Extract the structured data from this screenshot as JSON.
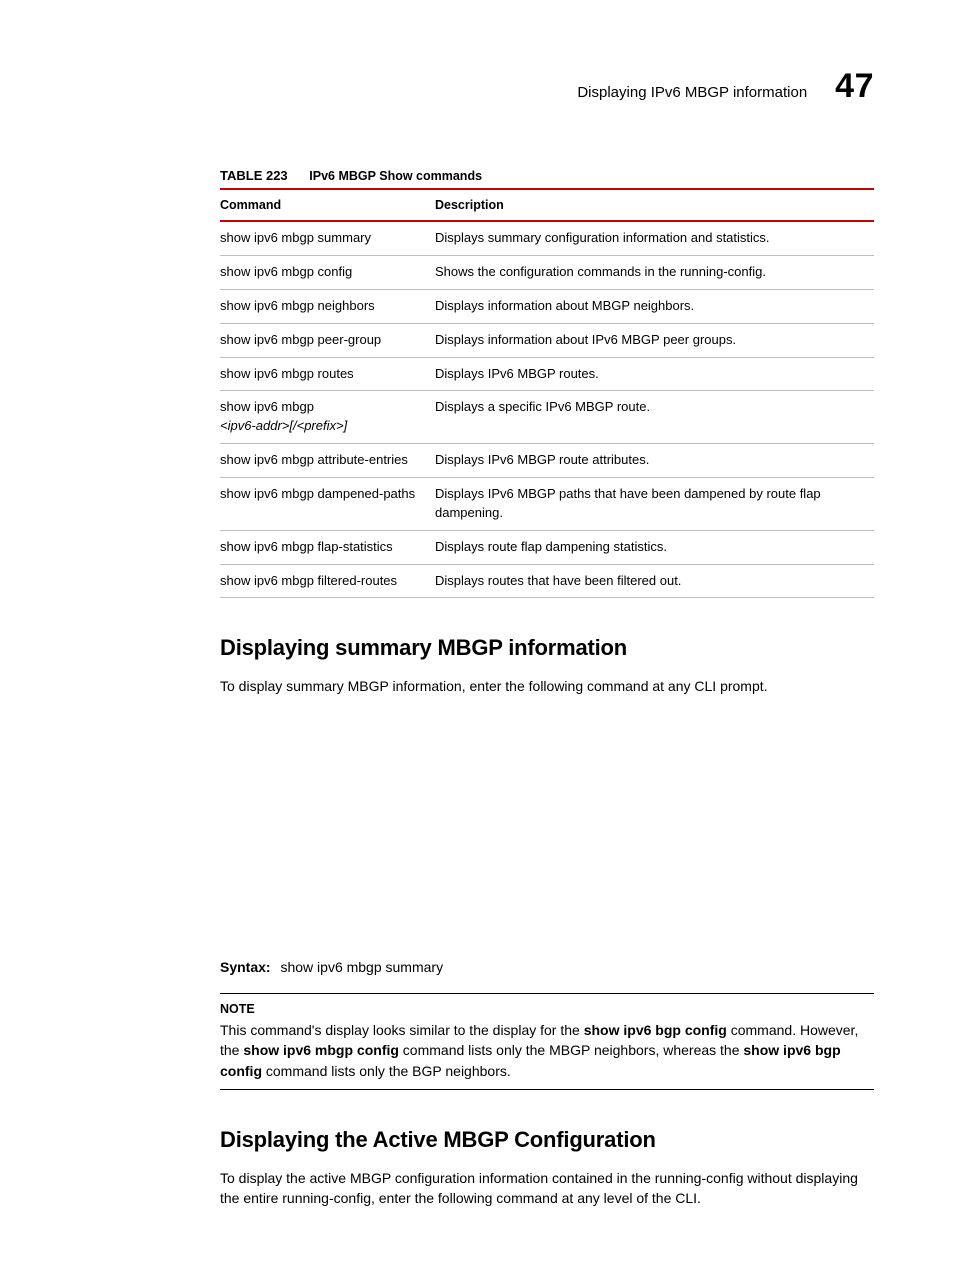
{
  "header": {
    "section_title": "Displaying IPv6 MBGP information",
    "chapter_number": "47"
  },
  "table": {
    "label": "TABLE 223",
    "title": "IPv6 MBGP Show commands",
    "col_command": "Command",
    "col_description": "Description",
    "rows": [
      {
        "command": "show ipv6 mbgp summary",
        "description": "Displays summary configuration information and statistics."
      },
      {
        "command": "show ipv6 mbgp config",
        "description": "Shows the configuration commands in the running-config."
      },
      {
        "command": "show ipv6 mbgp neighbors",
        "description": "Displays information about MBGP neighbors."
      },
      {
        "command": "show ipv6 mbgp peer-group",
        "description": "Displays information about IPv6 MBGP peer groups."
      },
      {
        "command": "show ipv6 mbgp routes",
        "description": "Displays IPv6 MBGP routes."
      },
      {
        "command_prefix": "show ipv6 mbgp",
        "command_param": "<ipv6-addr>[/<prefix>]",
        "description": "Displays a specific IPv6 MBGP route."
      },
      {
        "command": "show ipv6 mbgp attribute-entries",
        "description": "Displays IPv6 MBGP route attributes."
      },
      {
        "command": "show ipv6 mbgp dampened-paths",
        "description": "Displays IPv6 MBGP paths that have been dampened by route flap dampening."
      },
      {
        "command": "show ipv6 mbgp flap-statistics",
        "description": "Displays route flap dampening statistics."
      },
      {
        "command": "show ipv6 mbgp filtered-routes",
        "description": "Displays routes that have been filtered out."
      }
    ]
  },
  "section1": {
    "heading": "Displaying summary MBGP information",
    "intro": "To display summary MBGP information, enter the following command at any CLI prompt.",
    "syntax_label": "Syntax:",
    "syntax_text": "show ipv6 mbgp summary",
    "note_label": "NOTE",
    "note_parts": {
      "t1": "This command's display looks similar to the display for the ",
      "b1": "show ipv6 bgp config",
      "t2": " command. However, the ",
      "b2": "show ipv6 mbgp config",
      "t3": " command lists only the MBGP neighbors, whereas the ",
      "b3": "show ipv6 bgp config",
      "t4": " command lists only the BGP neighbors."
    }
  },
  "section2": {
    "heading": "Displaying the Active MBGP Configuration",
    "intro": "To display the active MBGP configuration information contained in the running-config without displaying the entire running-config, enter the following command at any level of the CLI."
  }
}
